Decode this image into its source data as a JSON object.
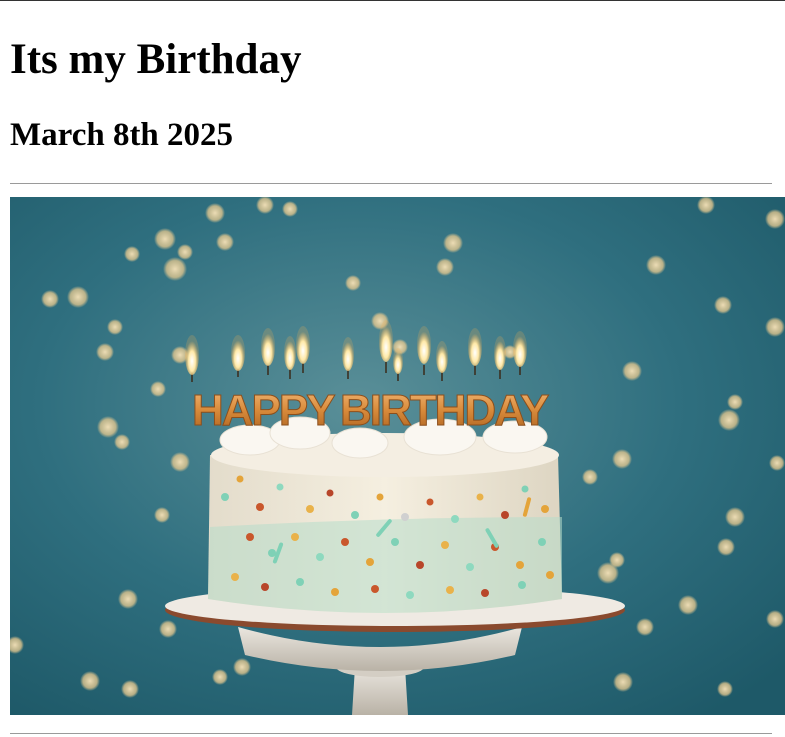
{
  "header": {
    "title": "Its my Birthday",
    "date": "March 8th 2025"
  },
  "hero_image": {
    "description_icon": "birthday-cake-image",
    "candle_letters": [
      "H",
      "A",
      "P",
      "P",
      "Y",
      "B",
      "I",
      "R",
      "T",
      "H",
      "D",
      "A",
      "Y"
    ],
    "colors": {
      "background": "#2f6f7f",
      "candle_gold": "#d88a3a",
      "frosting": "#f1ead8"
    }
  }
}
